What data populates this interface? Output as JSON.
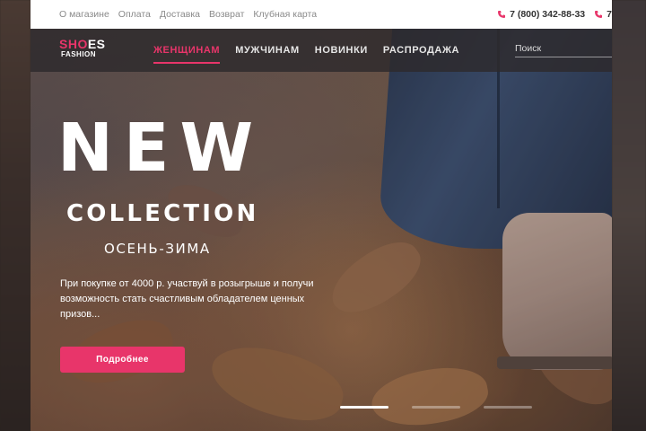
{
  "topbar": {
    "links": [
      "О магазине",
      "Оплата",
      "Доставка",
      "Возврат",
      "Клубная карта"
    ],
    "phones": [
      "7 (800) 342-88-33",
      "7"
    ]
  },
  "logo": {
    "accent": "SHO",
    "rest": "ES",
    "sub": "FASHION"
  },
  "nav": {
    "items": [
      "ЖЕНЩИНАМ",
      "МУЖЧИНАМ",
      "НОВИНКИ",
      "РАСПРОДАЖА"
    ],
    "active_index": 0
  },
  "search": {
    "placeholder": "Поиск"
  },
  "hero": {
    "headline": "NEW",
    "subheadline": "COLLECTION",
    "season": "ОСЕНЬ-ЗИМА",
    "promo": "При покупке от 4000 р. участвуй в розыгрыше и получи возможность стать счастливым обладателем ценных призов...",
    "cta_label": "Подробнее",
    "slides": 3,
    "active_slide": 0
  },
  "colors": {
    "accent": "#e8356a",
    "nav_bg": "#2d2a2c"
  }
}
